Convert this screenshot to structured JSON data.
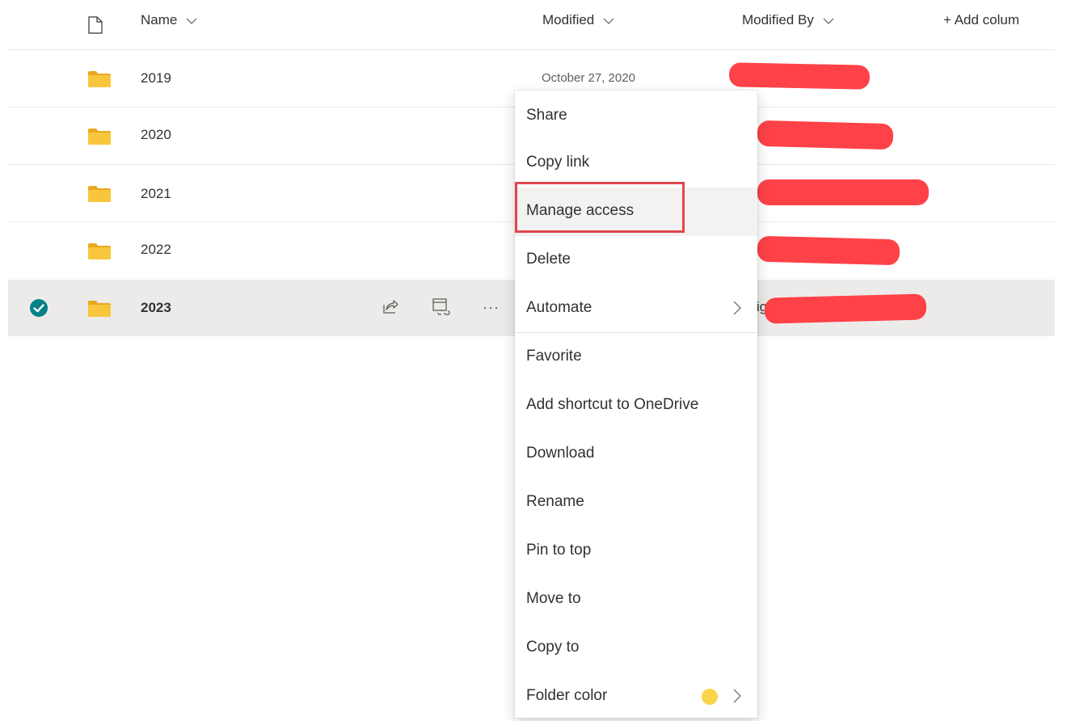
{
  "columns": {
    "name": "Name",
    "modified": "Modified",
    "modified_by": "Modified By",
    "add_column": "+ Add colum"
  },
  "rows": [
    {
      "name": "2019",
      "modified": "October 27, 2020",
      "selected": false
    },
    {
      "name": "2020",
      "modified": "",
      "selected": false
    },
    {
      "name": "2021",
      "modified": "",
      "selected": false
    },
    {
      "name": "2022",
      "modified": "",
      "selected": false
    },
    {
      "name": "2023",
      "modified": "",
      "selected": true,
      "partial_text": "ig"
    }
  ],
  "row_actions": {
    "share": "share-icon",
    "copy_link": "copy-link-icon",
    "more": "···"
  },
  "context_menu": {
    "items": [
      {
        "label": "Share"
      },
      {
        "label": "Copy link"
      },
      {
        "label": "Manage access",
        "highlighted": true
      },
      {
        "label": "Delete"
      },
      {
        "label": "Automate",
        "submenu": true
      },
      {
        "label": "Favorite"
      },
      {
        "label": "Add shortcut to OneDrive"
      },
      {
        "label": "Download"
      },
      {
        "label": "Rename"
      },
      {
        "label": "Pin to top"
      },
      {
        "label": "Move to"
      },
      {
        "label": "Copy to"
      },
      {
        "label": "Folder color",
        "submenu": true,
        "swatch_color": "#f9d349"
      }
    ]
  },
  "colors": {
    "folder": "#f8c63d",
    "folder_tab": "#e9a91e",
    "redaction": "#ff4148",
    "highlight_border": "#e0474d",
    "selected_row_bg": "#edebe9",
    "check_circle": "#038387"
  }
}
